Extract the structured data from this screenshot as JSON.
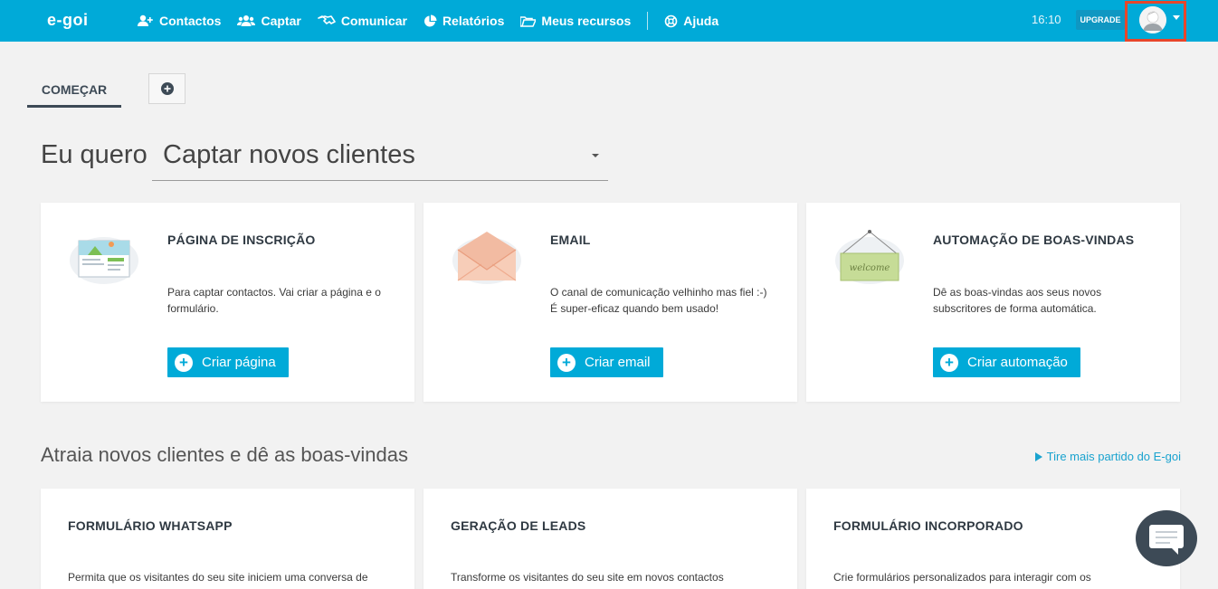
{
  "header": {
    "logo": "e-goi",
    "nav": [
      {
        "label": "Contactos",
        "icon": "add-contact-icon"
      },
      {
        "label": "Captar",
        "icon": "users-icon"
      },
      {
        "label": "Comunicar",
        "icon": "handshake-icon"
      },
      {
        "label": "Relatórios",
        "icon": "pie-chart-icon"
      },
      {
        "label": "Meus recursos",
        "icon": "folder-icon"
      },
      {
        "label": "Ajuda",
        "icon": "lifebuoy-icon"
      }
    ],
    "time": "16:10",
    "upgrade": "UPGRADE"
  },
  "tabs": {
    "start": "COMEÇAR"
  },
  "goal": {
    "prefix": "Eu quero",
    "selected": "Captar novos clientes"
  },
  "cards": [
    {
      "title": "PÁGINA DE INSCRIÇÃO",
      "desc": "Para captar contactos. Vai criar a página e o formulário.",
      "button": "Criar página"
    },
    {
      "title": "EMAIL",
      "desc": "O canal de comunicação velhinho mas fiel :-) É super-eficaz quando bem usado!",
      "button": "Criar email"
    },
    {
      "title": "AUTOMAÇÃO DE BOAS-VINDAS",
      "desc": "Dê as boas-vindas aos seus novos subscritores de forma automática.",
      "button": "Criar automação",
      "sign_text": "welcome"
    }
  ],
  "section": {
    "title": "Atraia novos clientes e dê as boas-vindas",
    "link": "Tire mais partido do E-goi"
  },
  "cards2": [
    {
      "title": "FORMULÁRIO WHATSAPP",
      "desc": "Permita que os visitantes do seu site iniciem uma conversa de"
    },
    {
      "title": "GERAÇÃO DE LEADS",
      "desc": "Transforme os visitantes do seu site em novos contactos"
    },
    {
      "title": "FORMULÁRIO INCORPORADO",
      "desc": "Crie formulários personalizados para interagir com os"
    }
  ],
  "colors": {
    "brand": "#00aad8",
    "highlight": "#e8462a",
    "dark": "#3d4a56"
  }
}
